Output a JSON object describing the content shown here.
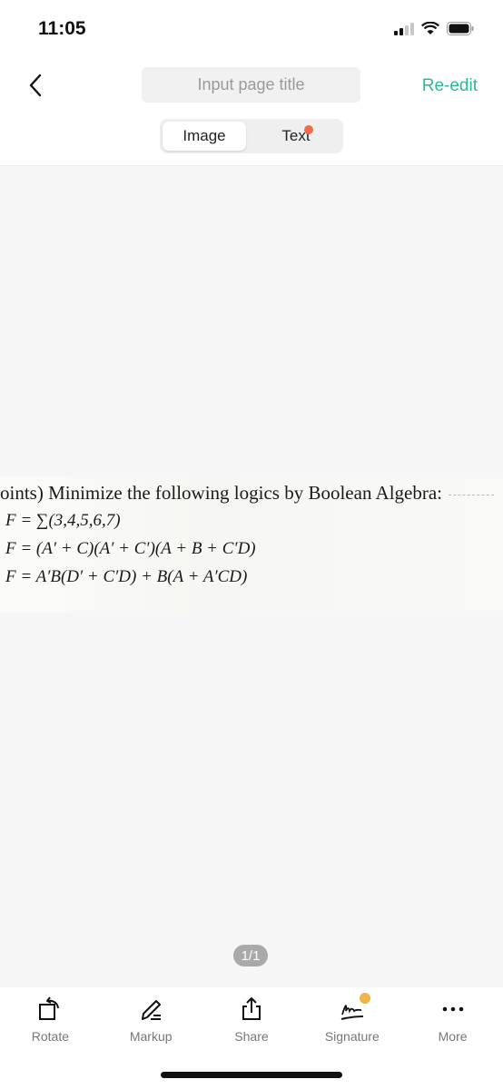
{
  "status_bar": {
    "time": "11:05",
    "signal_icon": "signal-icon",
    "wifi_icon": "wifi-icon",
    "battery_icon": "battery-icon"
  },
  "nav": {
    "back_icon": "chevron-left-icon",
    "title_placeholder": "Input page title",
    "title_value": "",
    "reedit_label": "Re-edit",
    "accent_color": "#2db89a"
  },
  "segments": {
    "items": [
      {
        "label": "Image",
        "active": true
      },
      {
        "label": "Text",
        "active": false,
        "badge_dot": true
      }
    ],
    "dot_color": "#f06a4e"
  },
  "document": {
    "lines": [
      "oints) Minimize the following logics by Boolean Algebra:",
      "F = ∑(3,4,5,6,7)",
      "F = (A′ + C)(A′ + C′)(A + B + C′D)",
      "F = A′B(D′ + C′D) + B(A + A′CD)"
    ]
  },
  "pager": {
    "label": "1/1"
  },
  "toolbar": {
    "items": [
      {
        "label": "Rotate",
        "icon": "rotate-icon"
      },
      {
        "label": "Markup",
        "icon": "pen-icon"
      },
      {
        "label": "Share",
        "icon": "share-icon"
      },
      {
        "label": "Signature",
        "icon": "signature-icon",
        "premium": true
      },
      {
        "label": "More",
        "icon": "more-icon"
      }
    ]
  }
}
